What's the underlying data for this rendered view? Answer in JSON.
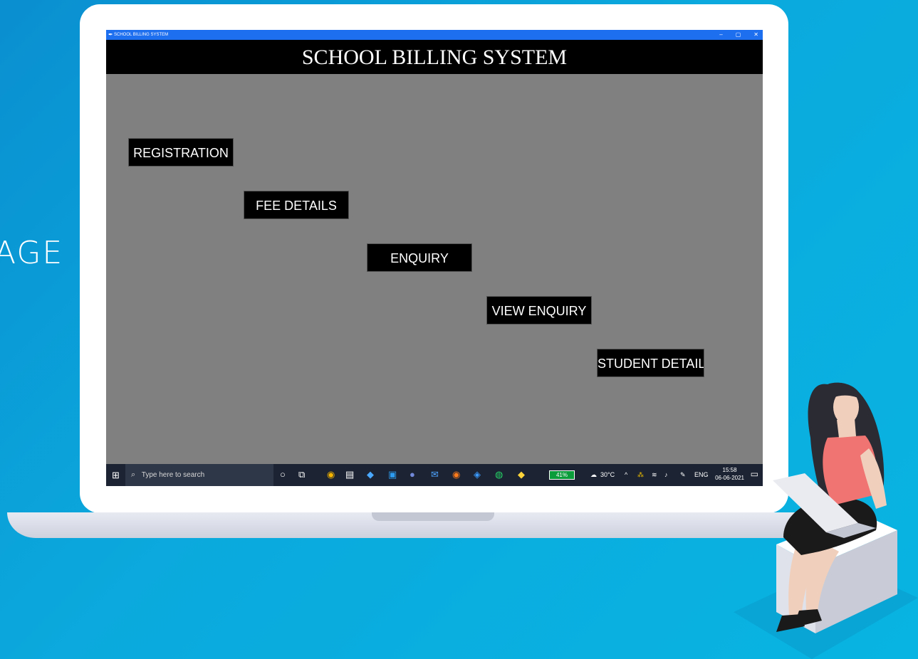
{
  "background_label": "AGE",
  "window": {
    "title": "SCHOOL BILLING SYSTEM",
    "controls": [
      "–",
      "▢",
      "✕"
    ]
  },
  "app": {
    "heading": "SCHOOL BILLING SYSTEM",
    "buttons": {
      "registration": "REGISTRATION",
      "fee_details": "FEE DETAILS",
      "enquiry": "ENQUIRY",
      "view_enquiry": "VIEW ENQUIRY",
      "student_details": "STUDENT DETAILS"
    }
  },
  "taskbar": {
    "search_placeholder": "Type here to search",
    "battery": "41%",
    "weather": "30°C",
    "language": "ENG",
    "time": "15:58",
    "date": "06-06-2021"
  },
  "colors": {
    "window_background": "#808080",
    "header_background": "#000000",
    "titlebar": "#1e6ef0",
    "taskbar": "#1c2433",
    "page_background": "#0ba9dd"
  }
}
